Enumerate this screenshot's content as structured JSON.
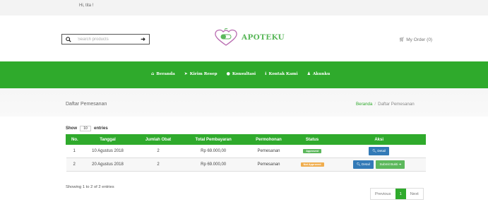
{
  "topbar": {
    "greeting": "Hi, tita !"
  },
  "header": {
    "search_placeholder": "Search products",
    "brand": "APOTEKU",
    "my_order": "My Order (0)"
  },
  "nav": [
    {
      "label": "Beranda",
      "icon": "home-icon"
    },
    {
      "label": "Kirim Resep",
      "icon": "paper-plane-icon"
    },
    {
      "label": "Konsultasi",
      "icon": "comment-icon"
    },
    {
      "label": "Kontak Kami",
      "icon": "info-icon"
    },
    {
      "label": "Akunku",
      "icon": "user-icon"
    }
  ],
  "page": {
    "title": "Daftar Pemesanan",
    "breadcrumb_home": "Beranda",
    "breadcrumb_sep": "/",
    "breadcrumb_current": "Daftar Pemesanan"
  },
  "table": {
    "show_label": "Show",
    "show_value": "10",
    "entries_label": "entries",
    "columns": [
      "No.",
      "Tanggal",
      "Jumlah Obat",
      "Total Pembayaran",
      "Permohonan",
      "Status",
      "Aksi"
    ],
    "rows": [
      {
        "no": "1",
        "tanggal": "10 Agustus 2018",
        "jumlah": "2",
        "total": "Rp 69.000,00",
        "permohonan": "Pemesanan",
        "status": "Approved",
        "detail": "Detail",
        "submit": ""
      },
      {
        "no": "2",
        "tanggal": "20 Agustus 2018",
        "jumlah": "2",
        "total": "Rp 69.000,00",
        "permohonan": "Pemesanan",
        "status": "Not Approved",
        "detail": "Detail",
        "submit": "Submit Bukti"
      }
    ],
    "showing_text": "Showing 1 to 2 of 2 entries"
  },
  "pagination": {
    "previous": "Previous",
    "current": "1",
    "next": "Next"
  },
  "colors": {
    "brand_green": "#2faa2c",
    "approved": "#5cb85c",
    "not_approved": "#f0ad4e",
    "detail_blue": "#337ab7"
  }
}
